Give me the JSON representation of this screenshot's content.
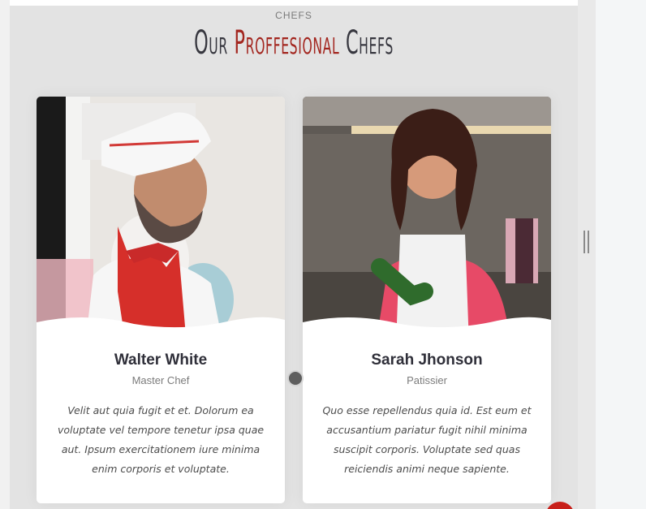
{
  "section": {
    "subtitle": "CHEFS",
    "title_part1": "Our ",
    "title_accent": "Proffesional",
    "title_part2": " Chefs"
  },
  "chefs": [
    {
      "name": "Walter White",
      "role": "Master Chef",
      "bio": "Velit aut quia fugit et et. Dolorum ea voluptate vel tempore tenetur ipsa quae aut. Ipsum exercitationem iure minima enim corporis et voluptate.",
      "image_icon": "chef-photo-icon"
    },
    {
      "name": "Sarah Jhonson",
      "role": "Patissier",
      "bio": "Quo esse repellendus quia id. Est eum et accusantium pariatur fugit nihil minima suscipit corporis. Voluptate sed quas reiciendis animi neque sapiente.",
      "image_icon": "chef-photo-icon"
    }
  ],
  "colors": {
    "accent": "#a3261f",
    "title": "#37373f",
    "fab": "#c8201a"
  }
}
